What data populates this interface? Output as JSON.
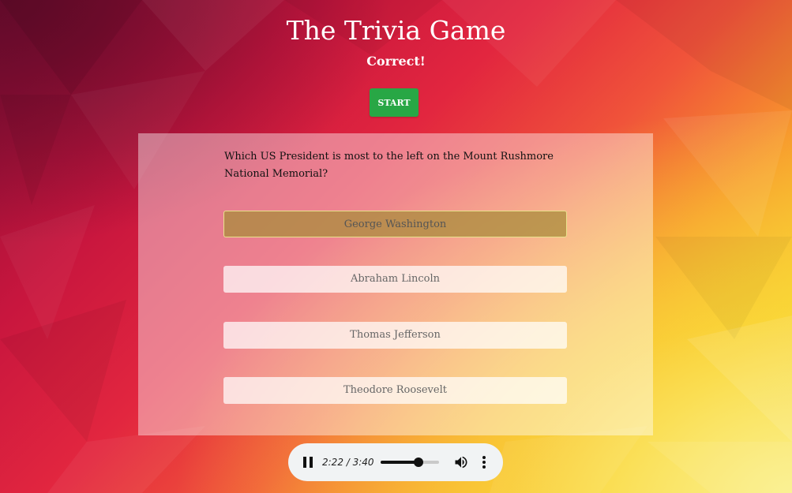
{
  "header": {
    "title": "The Trivia Game",
    "status": "Correct!"
  },
  "controls": {
    "start_label": "START"
  },
  "quiz": {
    "question": "Which US President is most to the left on the Mount Rushmore National Memorial?",
    "answers": [
      {
        "label": "George Washington",
        "selected": true
      },
      {
        "label": "Abraham Lincoln",
        "selected": false
      },
      {
        "label": "Thomas Jefferson",
        "selected": false
      },
      {
        "label": "Theodore Roosevelt",
        "selected": false
      }
    ]
  },
  "audio_player": {
    "time_display": "2:22 / 3:40",
    "progress_fraction": 0.645,
    "playing": true,
    "icons": {
      "play_state": "pause-icon",
      "volume": "volume-icon",
      "menu": "more-vert-icon"
    }
  },
  "colors": {
    "start_button": "#28a745",
    "selected_answer": "#aa8c3c",
    "panel_overlay": "rgba(255,255,255,0.42)",
    "player_background": "#f1f3f4"
  }
}
